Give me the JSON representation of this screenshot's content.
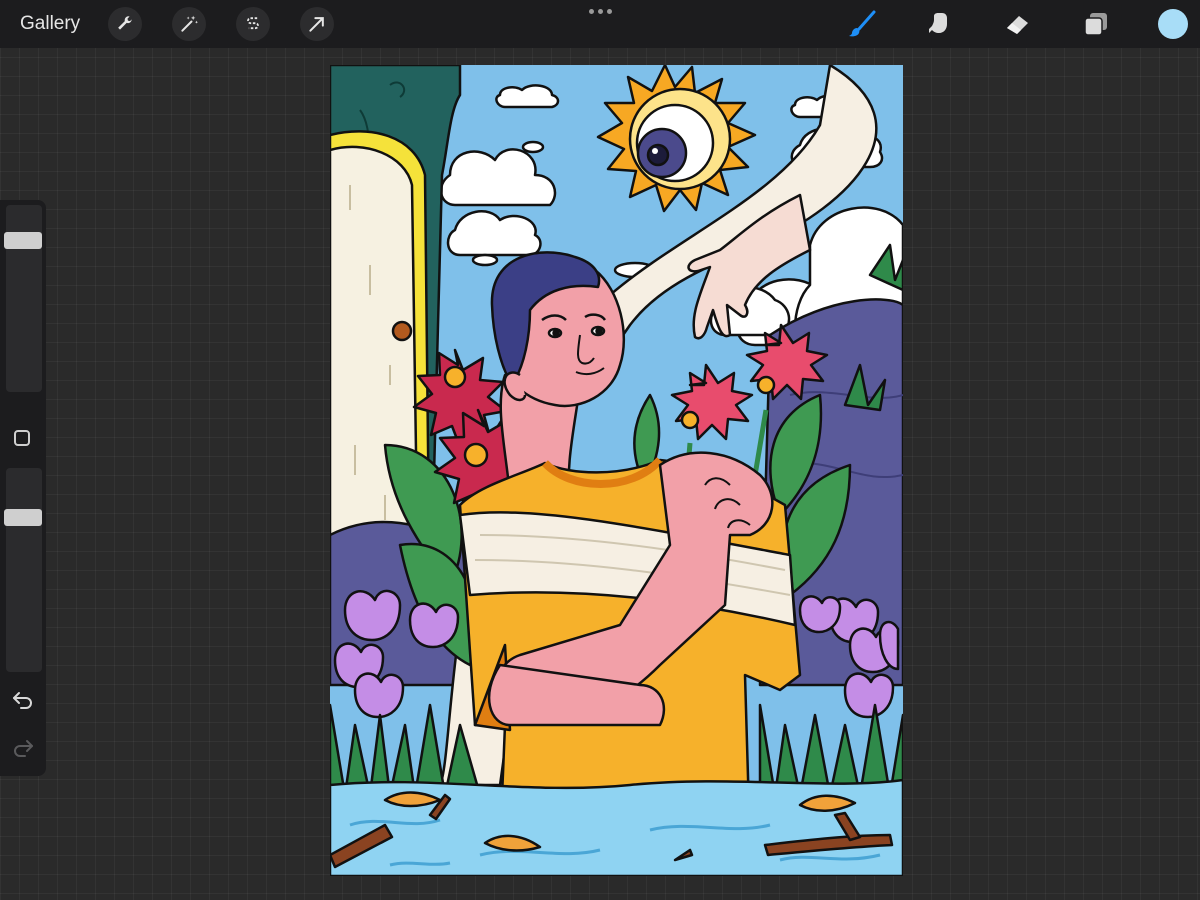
{
  "toolbar": {
    "gallery_label": "Gallery",
    "left_tools": [
      {
        "name": "actions",
        "icon": "wrench-icon"
      },
      {
        "name": "adjustments",
        "icon": "magic-wand-icon"
      },
      {
        "name": "selection",
        "icon": "selection-s-icon"
      },
      {
        "name": "transform",
        "icon": "arrow-cursor-icon"
      }
    ],
    "more_icon": "ellipsis-icon",
    "right_tools": [
      {
        "name": "brush",
        "icon": "brush-icon",
        "active": true
      },
      {
        "name": "smudge",
        "icon": "smudge-finger-icon",
        "active": false
      },
      {
        "name": "eraser",
        "icon": "eraser-icon",
        "active": false
      },
      {
        "name": "layers",
        "icon": "layers-icon",
        "active": false
      }
    ],
    "current_color": "#a8ddf7",
    "active_tool_color": "#1e8ff7"
  },
  "sidebar": {
    "brush_size_level": 0.84,
    "opacity_level": 0.78,
    "modify_icon": "square-icon",
    "undo_icon": "undo-icon",
    "redo_icon": "redo-icon",
    "redo_enabled": false
  },
  "canvas": {
    "content": "illustration",
    "palette": {
      "sky": "#7fc0ea",
      "sun": "#f7a823",
      "shirt": "#f6b12b",
      "skin": "#f2a0a8",
      "water": "#8fd3f2",
      "leaf": "#3f9a52",
      "tulip": "#c48de6",
      "rock": "#5a5a9a",
      "pillar": "#22625e",
      "door": "#f6f1e1"
    }
  }
}
